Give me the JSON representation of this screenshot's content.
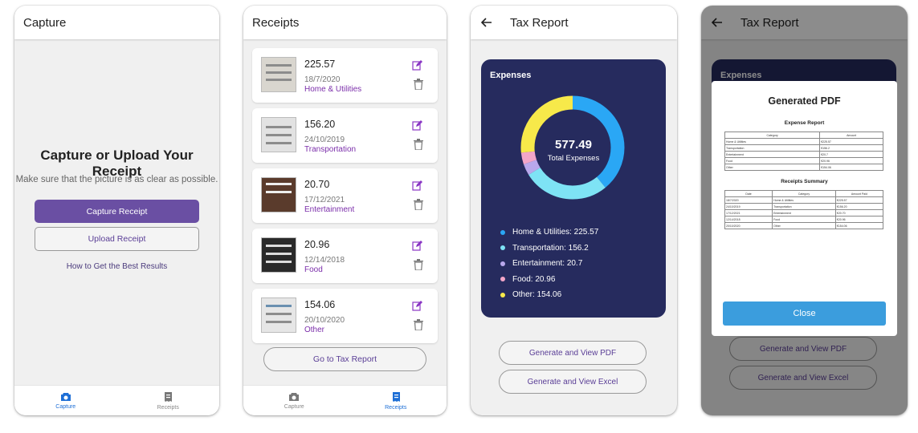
{
  "colors": {
    "accent": "#6a4fa3",
    "nav_active": "#1e6fd6",
    "category": "#7b2eaa",
    "chart_bg": "#262b5e",
    "dialog_button": "#3b9ddd"
  },
  "capture_screen": {
    "title": "Capture",
    "heading": "Capture or Upload Your Receipt",
    "subtitle": "Make sure that the picture is as clear as possible.",
    "capture_button": "Capture Receipt",
    "upload_button": "Upload Receipt",
    "tips_link": "How to Get the Best Results",
    "nav": [
      {
        "label": "Capture",
        "icon": "camera-icon",
        "active": true
      },
      {
        "label": "Receipts",
        "icon": "receipt-icon",
        "active": false
      }
    ]
  },
  "receipts_screen": {
    "title": "Receipts",
    "items": [
      {
        "amount": "225.57",
        "date": "18/7/2020",
        "category": "Home & Utilities"
      },
      {
        "amount": "156.20",
        "date": "24/10/2019",
        "category": "Transportation"
      },
      {
        "amount": "20.70",
        "date": "17/12/2021",
        "category": "Entertainment"
      },
      {
        "amount": "20.96",
        "date": "12/14/2018",
        "category": "Food"
      },
      {
        "amount": "154.06",
        "date": "20/10/2020",
        "category": "Other"
      }
    ],
    "go_button": "Go to Tax Report",
    "nav": [
      {
        "label": "Capture",
        "icon": "camera-icon",
        "active": false
      },
      {
        "label": "Receipts",
        "icon": "receipt-icon",
        "active": true
      }
    ]
  },
  "tax_report_screen": {
    "title": "Tax Report",
    "card_title": "Expenses",
    "total_value": "577.49",
    "total_label": "Total Expenses",
    "legend": [
      {
        "label": "Home & Utilities: 225.57",
        "color": "#2aa7f5"
      },
      {
        "label": "Transportation: 156.2",
        "color": "#7ee3f5"
      },
      {
        "label": "Entertainment: 20.7",
        "color": "#b9a8ec"
      },
      {
        "label": "Food: 20.96",
        "color": "#f3a6c8"
      },
      {
        "label": "Other: 154.06",
        "color": "#f7e94a"
      }
    ],
    "pdf_button": "Generate and View PDF",
    "excel_button": "Generate and View Excel"
  },
  "chart_data": {
    "type": "pie",
    "title": "Expenses",
    "categories": [
      "Home & Utilities",
      "Transportation",
      "Entertainment",
      "Food",
      "Other"
    ],
    "values": [
      225.57,
      156.2,
      20.7,
      20.96,
      154.06
    ],
    "colors": [
      "#2aa7f5",
      "#7ee3f5",
      "#b9a8ec",
      "#f3a6c8",
      "#f7e94a"
    ],
    "legend": "bottom"
  },
  "pdf_dialog_screen": {
    "title": "Tax Report",
    "card_title": "Expenses",
    "dialog_title": "Generated PDF",
    "report_heading": "Expense Report",
    "report_columns": [
      "Category",
      "Amount"
    ],
    "report_rows": [
      [
        "Home & Utilities",
        "€225.57"
      ],
      [
        "Transportation",
        "€156.2"
      ],
      [
        "Entertainment",
        "€20.7"
      ],
      [
        "Food",
        "€20.96"
      ],
      [
        "Other",
        "€154.06"
      ]
    ],
    "summary_heading": "Receipts Summary",
    "summary_columns": [
      "Date",
      "Category",
      "Amount Paid"
    ],
    "summary_rows": [
      [
        "18/7/2020",
        "Home & Utilities",
        "€225.57"
      ],
      [
        "24/10/2019",
        "Transportation",
        "€156.20"
      ],
      [
        "17/12/2021",
        "Entertainment",
        "€20.70"
      ],
      [
        "12/14/2018",
        "Food",
        "€20.96"
      ],
      [
        "20/10/2020",
        "Other",
        "€154.06"
      ]
    ],
    "close_button": "Close",
    "pdf_button": "Generate and View PDF",
    "excel_button": "Generate and View Excel"
  }
}
